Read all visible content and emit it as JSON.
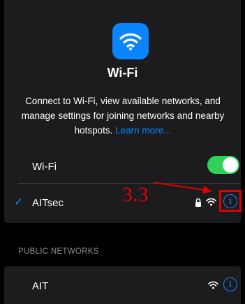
{
  "header": {
    "title": "Wi-Fi",
    "description": "Connect to Wi-Fi, view available networks, and manage settings for joining networks and nearby hotspots.",
    "learn_more": "Learn more..."
  },
  "wifi_toggle": {
    "label": "Wi-Fi",
    "on": true
  },
  "connected_network": {
    "name": "AITsec",
    "secured": true,
    "selected": true
  },
  "annotation": {
    "label": "3.3",
    "color": "#e10000"
  },
  "public_networks": {
    "header": "PUBLIC NETWORKS",
    "items": [
      {
        "name": "AIT",
        "secured": false
      }
    ]
  },
  "colors": {
    "accent": "#0a84ff",
    "toggle_on": "#30d158",
    "background": "#000000",
    "card": "#1c1c1e"
  },
  "icons": [
    "wifi-icon",
    "checkmark-icon",
    "lock-icon",
    "info-icon"
  ]
}
